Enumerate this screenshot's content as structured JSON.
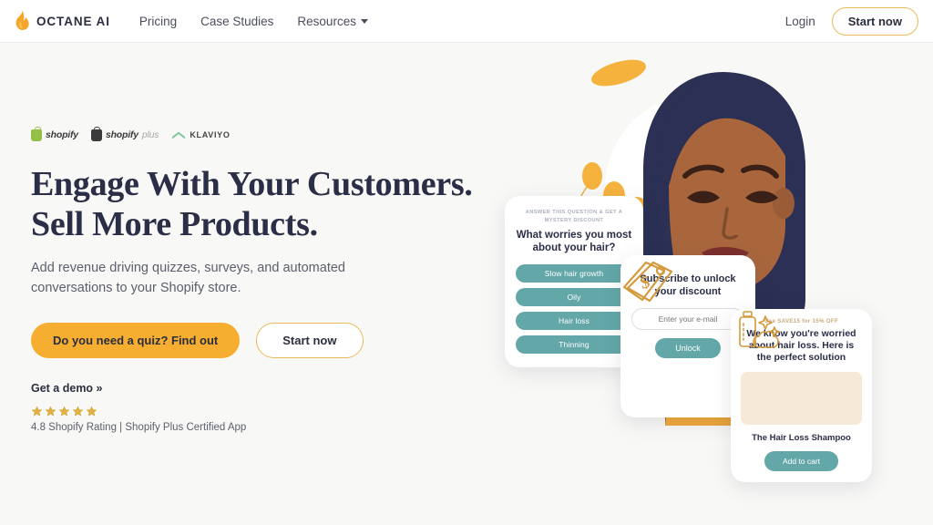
{
  "header": {
    "brand_name": "OCTANE AI",
    "logo_icon": "flame-icon",
    "nav": [
      {
        "label": "Pricing",
        "has_caret": false
      },
      {
        "label": "Case Studies",
        "has_caret": false
      },
      {
        "label": "Resources",
        "has_caret": true
      }
    ],
    "login_label": "Login",
    "start_now_label": "Start now"
  },
  "hero": {
    "partners": [
      {
        "name": "shopify",
        "icon": "shopify-bag-icon"
      },
      {
        "name": "shopify",
        "suffix": "plus",
        "icon": "shopify-plus-bag-icon"
      },
      {
        "name": "KLAVIYO",
        "icon": "klaviyo-icon"
      }
    ],
    "headline_line1": "Engage With Your Customers.",
    "headline_line2": "Sell More Products.",
    "subhead": "Add revenue driving quizzes, surveys, and automated conversations to your Shopify store.",
    "cta_primary": "Do you need a quiz? Find out",
    "cta_secondary": "Start now",
    "demo_link": "Get a demo »",
    "stars": 5,
    "rating_text": "4.8 Shopify Rating | Shopify Plus Certified App"
  },
  "illustration": {
    "quiz_card": {
      "kicker": "ANSWER THIS QUESTION & GET A MYSTERY DISCOUNT",
      "question": "What worries you most about your hair?",
      "options": [
        "Slow hair growth",
        "Oily",
        "Hair loss",
        "Thinning"
      ]
    },
    "subscribe_card": {
      "icon": "price-tag-icon",
      "title": "Subscribe to unlock your discount",
      "email_placeholder": "Enter your e-mail",
      "button_label": "Unlock"
    },
    "product_card": {
      "promo": "Use SAVE15 for 15% OFF",
      "headline": "We know you're worried about hair loss. Here is the perfect solution",
      "product_image_icon": "shampoo-bottle-icon",
      "product_name": "The Hair Loss Shampoo",
      "button_label": "Add to cart"
    }
  },
  "colors": {
    "accent_orange": "#f5ae30",
    "accent_gold_border": "#e8bb56",
    "teal": "#63a7a8",
    "headline_navy": "#2b2e47",
    "page_bg": "#f8f8f7",
    "hair_navy": "#2b3054",
    "skin": "#a9663c",
    "leaf_yellow": "#f6b02b"
  }
}
